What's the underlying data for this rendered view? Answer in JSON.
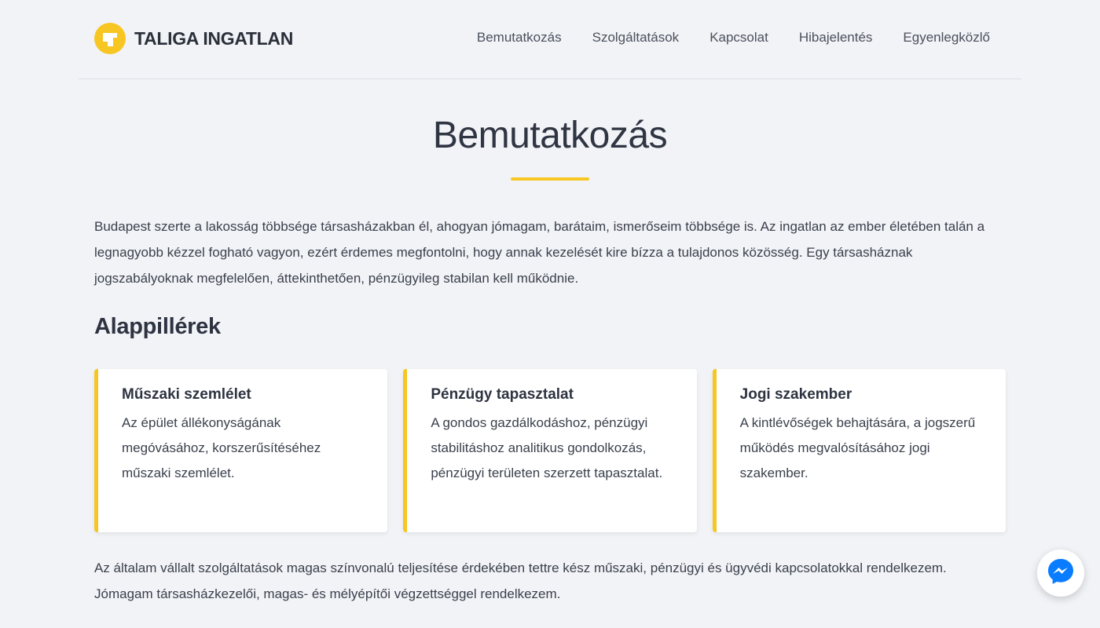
{
  "brand": {
    "name": "TALIGA INGATLAN",
    "logo_icon": "taliga-t-logo-icon",
    "accent_color": "#f7c623"
  },
  "nav": {
    "items": [
      {
        "label": "Bemutatkozás"
      },
      {
        "label": "Szolgáltatások"
      },
      {
        "label": "Kapcsolat"
      },
      {
        "label": "Hibajelentés"
      },
      {
        "label": "Egyenlegközlő"
      }
    ]
  },
  "main": {
    "title": "Bemutatkozás",
    "intro": "Budapest szerte a lakosság többsége társasházakban él, ahogyan jómagam, barátaim, ismerőseim többsége is. Az ingatlan az ember életében talán a legnagyobb kézzel fogható vagyon, ezért érdemes megfontolni, hogy annak kezelését kire bízza a tulajdonos közösség. Egy társasháznak jogszabályoknak megfelelően, áttekinthetően, pénzügyileg stabilan kell működnie.",
    "section_heading": "Alappillérek",
    "cards": [
      {
        "title": "Műszaki szemlélet",
        "text": "Az épület állékonyságának megóvásához, korszerűsítéséhez műszaki szemlélet."
      },
      {
        "title": "Pénzügy tapasztalat",
        "text": "A gondos gazdálkodáshoz, pénzügyi stabilitáshoz analitikus gondolkozás, pénzügyi területen szerzett tapasztalat."
      },
      {
        "title": "Jogi szakember",
        "text": "A kintlévőségek behajtására, a jogszerű működés megvalósításához jogi szakember."
      }
    ],
    "outro": "Az általam vállalt szolgáltatások magas színvonalú teljesítése érdekében tettre kész műszaki, pénzügyi és ügyvédi kapcsolatokkal rendelkezem. Jómagam társasházkezelői, magas- és mélyépítői végzettséggel rendelkezem."
  },
  "chat": {
    "icon": "messenger-icon",
    "color": "#0a7cff"
  }
}
